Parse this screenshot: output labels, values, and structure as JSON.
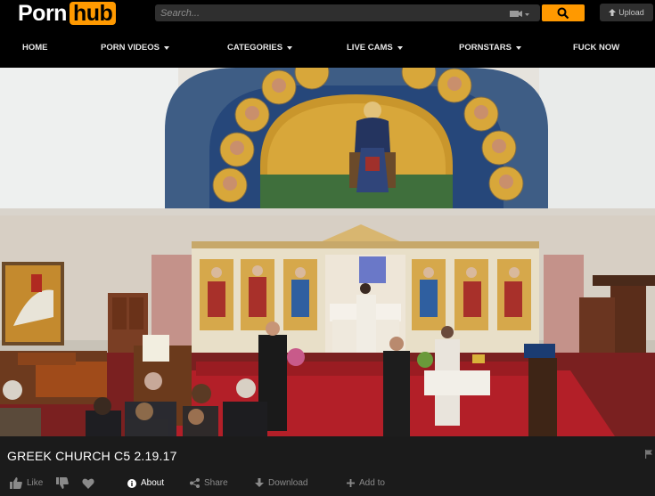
{
  "header": {
    "logo_part1": "Porn",
    "logo_part2": "hub",
    "search_placeholder": "Search...",
    "upload_label": "Upload"
  },
  "nav": {
    "items": [
      {
        "label": "HOME",
        "has_caret": false
      },
      {
        "label": "PORN VIDEOS",
        "has_caret": true
      },
      {
        "label": "CATEGORIES",
        "has_caret": true
      },
      {
        "label": "LIVE CAMS",
        "has_caret": true
      },
      {
        "label": "PORNSTARS",
        "has_caret": true
      },
      {
        "label": "FUCK NOW",
        "has_caret": false
      }
    ]
  },
  "video": {
    "title": "GREEK CHURCH C5 2.19.17"
  },
  "actions": {
    "like": "Like",
    "about": "About",
    "share": "Share",
    "download": "Download",
    "add_to": "Add to"
  },
  "colors": {
    "accent": "#ff9900",
    "background": "#1b1b1b",
    "topbar": "#000000"
  }
}
